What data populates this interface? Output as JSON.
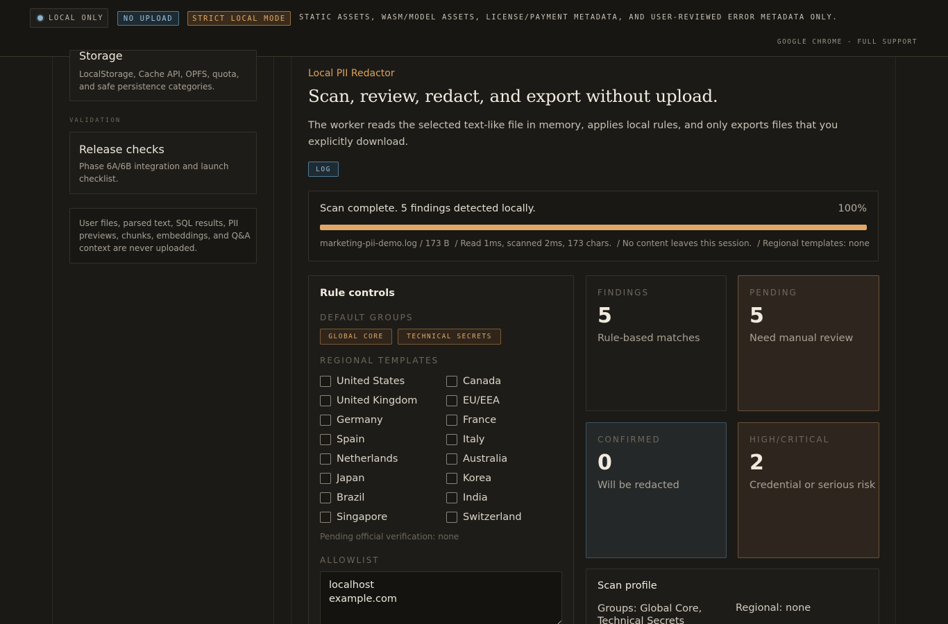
{
  "topbar": {
    "local_only": "LOCAL ONLY",
    "no_upload": "NO UPLOAD",
    "strict_mode": "STRICT LOCAL MODE",
    "policy": "STATIC ASSETS, WASM/MODEL ASSETS, LICENSE/PAYMENT METADATA, AND USER-REVIEWED ERROR METADATA ONLY.",
    "browser_support": "GOOGLE CHROME - FULL SUPPORT"
  },
  "sidebar": {
    "storage": {
      "title": "Storage",
      "desc": "LocalStorage, Cache API, OPFS, quota, and safe persistence categories."
    },
    "validation_label": "VALIDATION",
    "release": {
      "title": "Release checks",
      "desc": "Phase 6A/6B integration and launch checklist."
    },
    "privacy_note": "User files, parsed text, SQL results, PII previews, chunks, embeddings, and Q&A context are never uploaded."
  },
  "main": {
    "eyebrow": "Local PII Redactor",
    "title": "Scan, review, redact, and export without upload.",
    "lede": "The worker reads the selected text-like file in memory, applies local rules, and only exports files that you explicitly download.",
    "file_tag": "LOG",
    "scan": {
      "status": "Scan complete. 5 findings detected locally.",
      "percent_label": "100%",
      "progress": 1.0,
      "meta": [
        "marketing-pii-demo.log / 173 B",
        "/ Read 1ms, scanned 2ms, 173 chars.",
        "/ No content leaves this session.",
        "/ Regional templates: none"
      ]
    }
  },
  "rules": {
    "title": "Rule controls",
    "default_groups_label": "DEFAULT GROUPS",
    "default_groups": [
      "GLOBAL CORE",
      "TECHNICAL SECRETS"
    ],
    "regional_label": "REGIONAL TEMPLATES",
    "regions": [
      "United States",
      "Canada",
      "United Kingdom",
      "EU/EEA",
      "Germany",
      "France",
      "Spain",
      "Italy",
      "Netherlands",
      "Australia",
      "Japan",
      "Korea",
      "Brazil",
      "India",
      "Singapore",
      "Switzerland"
    ],
    "pending_note": "Pending official verification: none",
    "allowlist_label": "ALLOWLIST",
    "allowlist": [
      "localhost",
      "example.com"
    ]
  },
  "stats": {
    "findings": {
      "label": "FINDINGS",
      "value": "5",
      "desc": "Rule-based matches"
    },
    "pending": {
      "label": "PENDING",
      "value": "5",
      "desc": "Need manual review"
    },
    "confirmed": {
      "label": "CONFIRMED",
      "value": "0",
      "desc": "Will be redacted"
    },
    "high": {
      "label": "HIGH/CRITICAL",
      "value": "2",
      "desc": "Credential or serious risk"
    }
  },
  "profile": {
    "title": "Scan profile",
    "groups": "Groups: Global Core, Technical Secrets",
    "regional": "Regional: none"
  }
}
